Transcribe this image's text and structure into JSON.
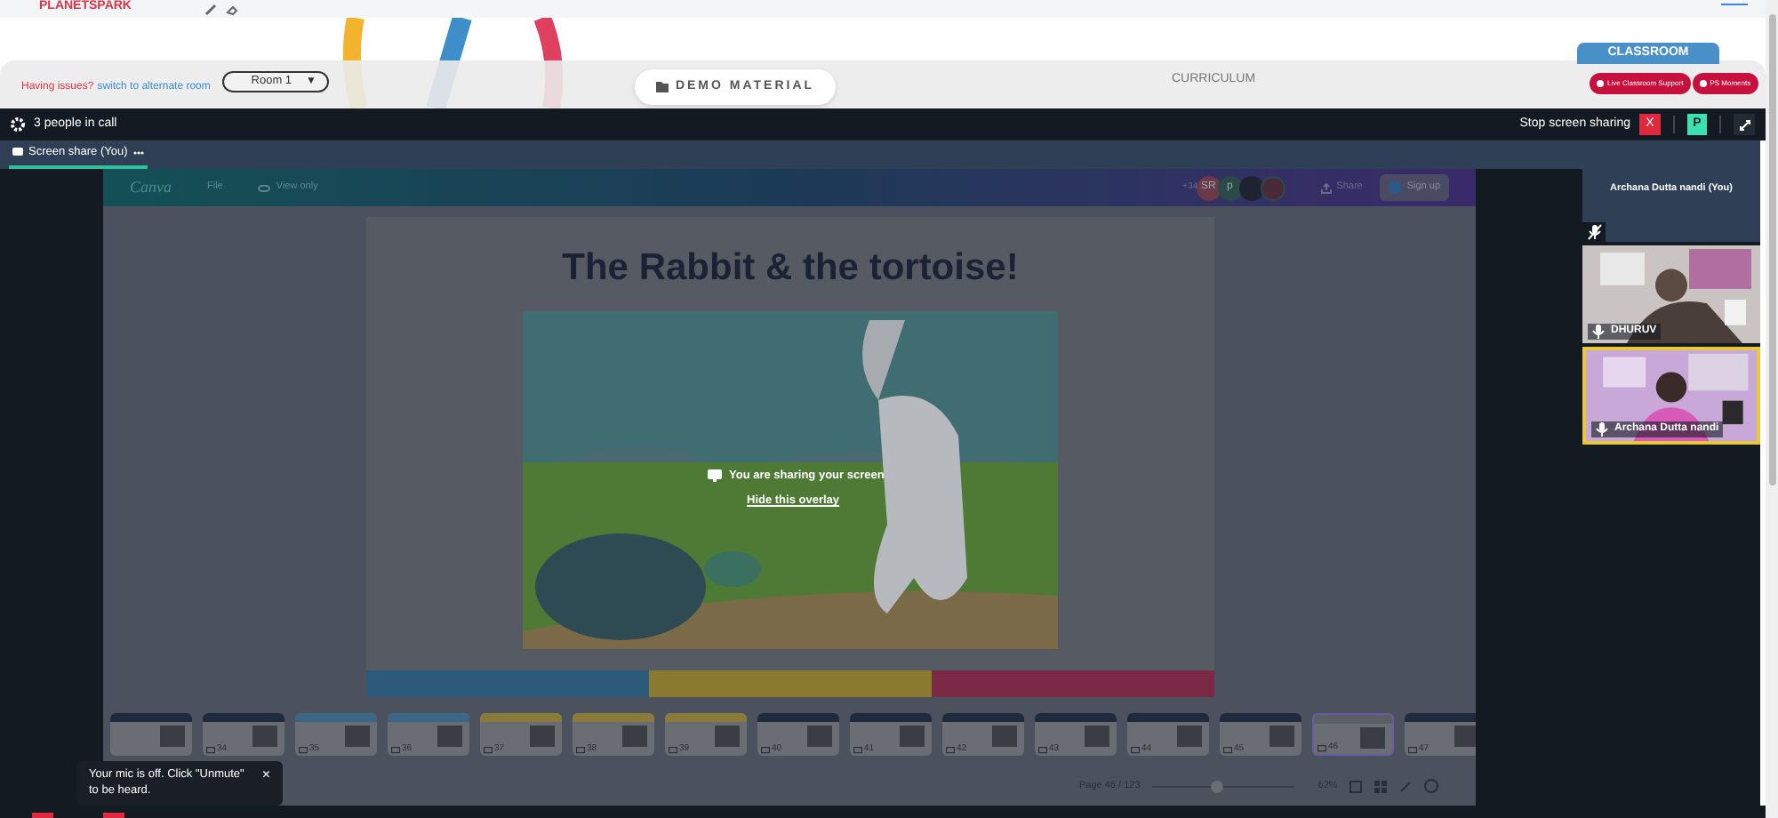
{
  "header": {
    "logo": "PLANETSPARK"
  },
  "room_bar": {
    "issue_text": "Having issues?",
    "switch_link": "switch to alternate room",
    "room_select": "Room 1",
    "select_caret": "▼",
    "demo_button": "DEMO MATERIAL",
    "curriculum": "CURRICULUM",
    "classroom_tab": "CLASSROOM",
    "pills": [
      "Live Classroom Support",
      "PS Moments"
    ]
  },
  "call_bar": {
    "people": "3 people in call",
    "stop_sharing": "Stop screen sharing",
    "stop_button": "X",
    "participant_button": "P"
  },
  "tabs": [
    {
      "label": "Screen share (You)",
      "selected": true
    }
  ],
  "canva": {
    "logo": "Canva",
    "menu": "File",
    "view_only": "View only",
    "extra_count": "+34",
    "avatars": [
      "SR",
      "p"
    ],
    "share": "Share",
    "sign_up": "Sign up"
  },
  "slide": {
    "title": "The Rabbit & the tortoise!"
  },
  "overlay": {
    "message": "You are sharing your screen",
    "link": "Hide this overlay"
  },
  "thumbnails": [
    {
      "color": "#1f2a3e",
      "selected": false
    },
    {
      "number": "34",
      "color": "#1f2a3e",
      "selected": false
    },
    {
      "number": "35",
      "color": "#3b6686",
      "selected": false
    },
    {
      "number": "36",
      "color": "#3b6686",
      "selected": false
    },
    {
      "number": "37",
      "color": "#8a7a3c",
      "selected": false
    },
    {
      "number": "38",
      "color": "#8a7a3c",
      "selected": false
    },
    {
      "number": "39",
      "color": "#8a7a3c",
      "selected": false
    },
    {
      "number": "40",
      "color": "#1f2a3e",
      "selected": false
    },
    {
      "number": "41",
      "color": "#1f2a3e",
      "selected": false
    },
    {
      "number": "42",
      "color": "#1f2a3e",
      "selected": false
    },
    {
      "number": "43",
      "color": "#1f2a3e",
      "selected": false
    },
    {
      "number": "44",
      "color": "#1f2a3e",
      "selected": false
    },
    {
      "number": "45",
      "color": "#1f2a3e",
      "selected": false
    },
    {
      "number": "46",
      "color": "#5a5f66",
      "selected": true
    },
    {
      "number": "47",
      "color": "#1f2a3e",
      "selected": false
    }
  ],
  "page_indicator": "Page 46 / 123",
  "zoom_slider": {
    "level": 0.45
  },
  "zoom": "62%",
  "participants": [
    {
      "name": "Archana Dutta nandi (You)",
      "kind": "avatar",
      "muted": true,
      "speaking": false
    },
    {
      "name": "DHURUV",
      "kind": "video",
      "muted": false,
      "speaking": false
    },
    {
      "name": "Archana Dutta nandi",
      "kind": "video",
      "muted": false,
      "speaking": true
    }
  ],
  "toast": {
    "message": "Your mic is off. Click \"Unmute\" to be heard.",
    "close": "×"
  }
}
